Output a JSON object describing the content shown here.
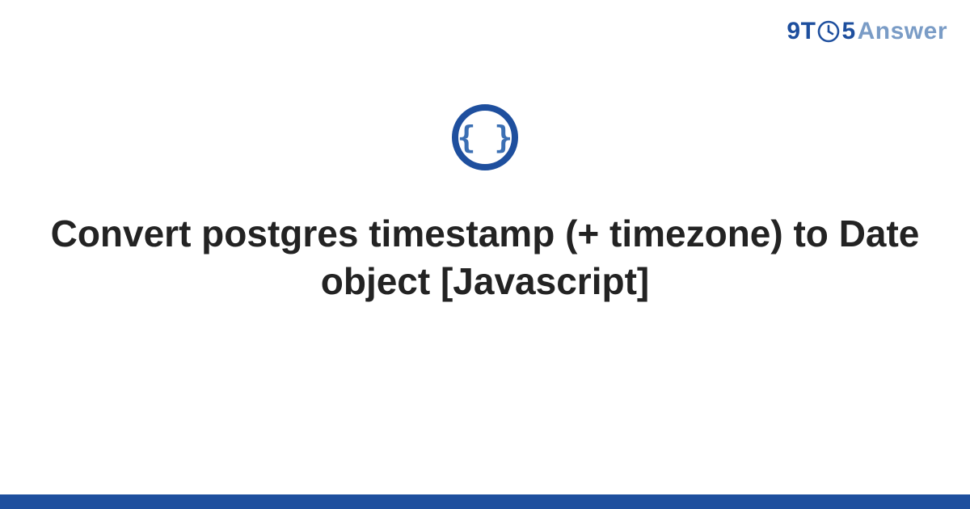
{
  "brand": {
    "part1": "9T",
    "part2": "5",
    "part3": "Answer",
    "accent_color": "#1e4f9e",
    "muted_color": "#7a9cc6"
  },
  "hero_icon": "code-braces-icon",
  "title": "Convert postgres timestamp (+ timezone) to Date object [Javascript]",
  "theme": {
    "bar_color": "#1e4f9e",
    "icon_ring_color": "#1e4f9e",
    "icon_glyph_color": "#3b6fb3"
  }
}
